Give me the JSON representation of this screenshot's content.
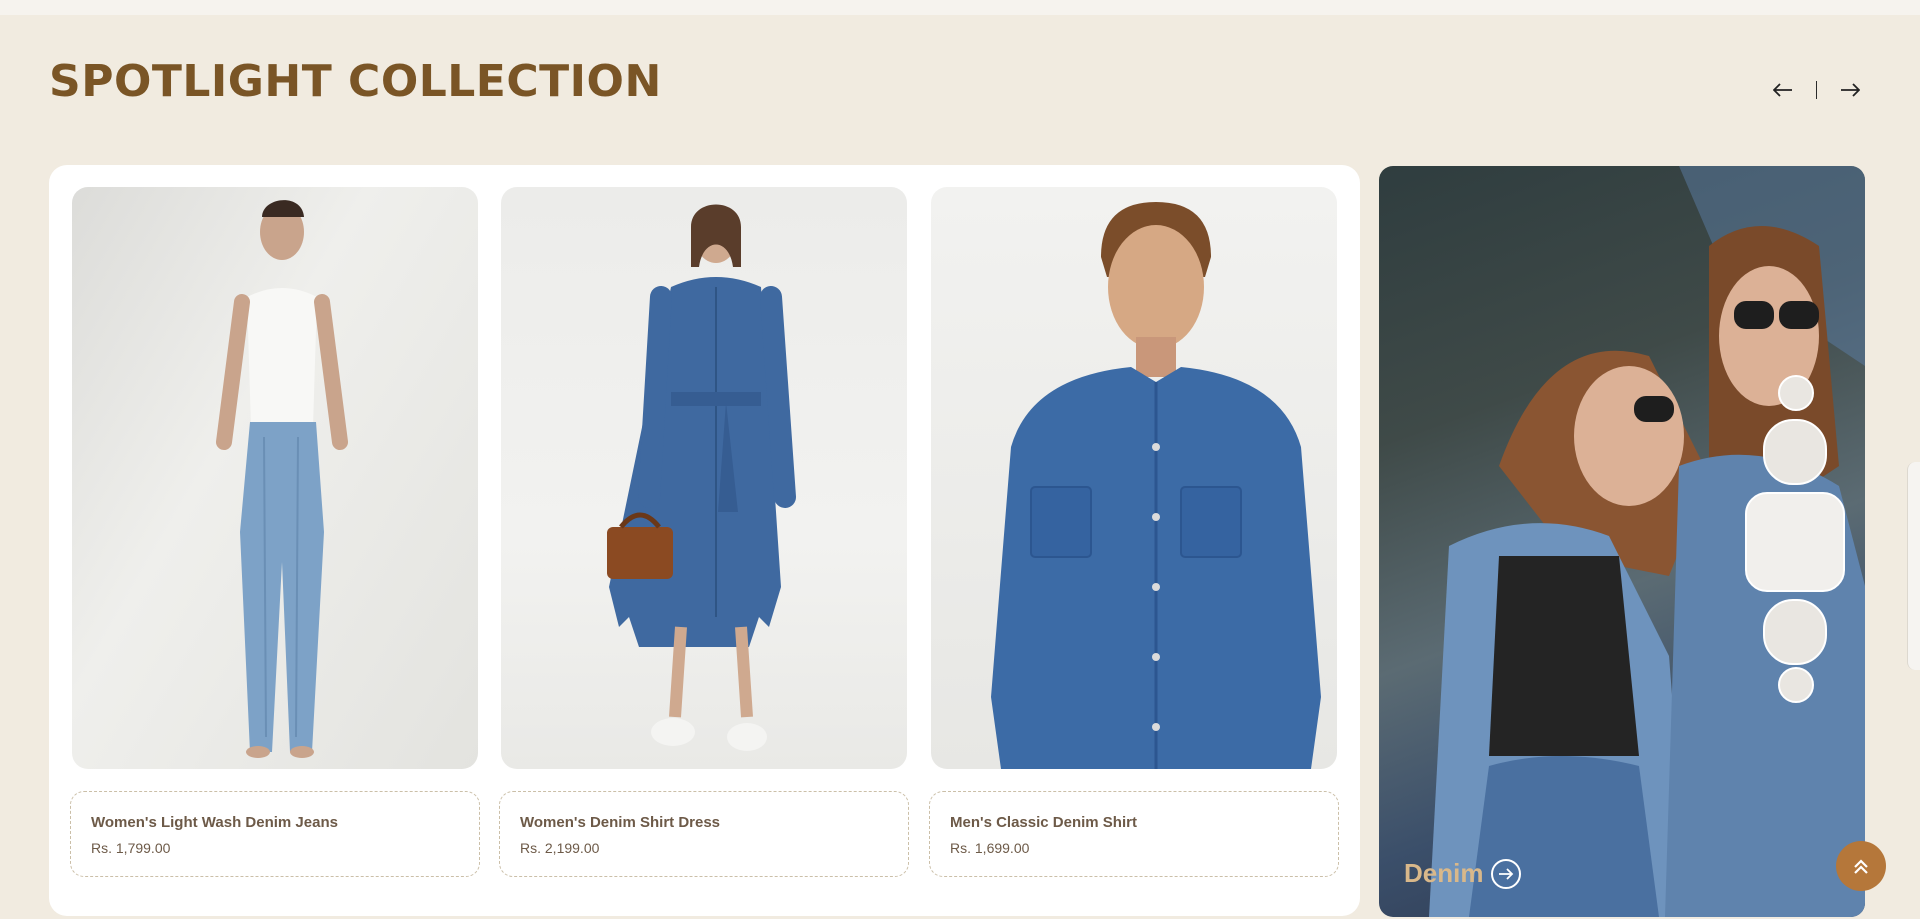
{
  "section": {
    "title": "SPOTLIGHT COLLECTION"
  },
  "nav": {
    "prev_icon": "arrow-left-icon",
    "next_icon": "arrow-right-icon"
  },
  "products": [
    {
      "name": "Women's Light Wash Denim Jeans",
      "price": "Rs. 1,799.00",
      "image": "woman-white-tank-light-jeans"
    },
    {
      "name": "Women's Denim Shirt Dress",
      "price": "Rs. 2,199.00",
      "image": "woman-denim-dress-brown-bag"
    },
    {
      "name": "Men's Classic Denim Shirt",
      "price": "Rs. 1,699.00",
      "image": "man-denim-shirt"
    }
  ],
  "feature": {
    "label": "Denim",
    "image": "two-women-denim-jackets-sunglasses"
  },
  "colors": {
    "accent": "#7a5526",
    "background": "#f1ebe0",
    "button": "#b5773a",
    "feature_label": "#d9b88a"
  },
  "scroll_top_icon": "double-chevron-up-icon"
}
